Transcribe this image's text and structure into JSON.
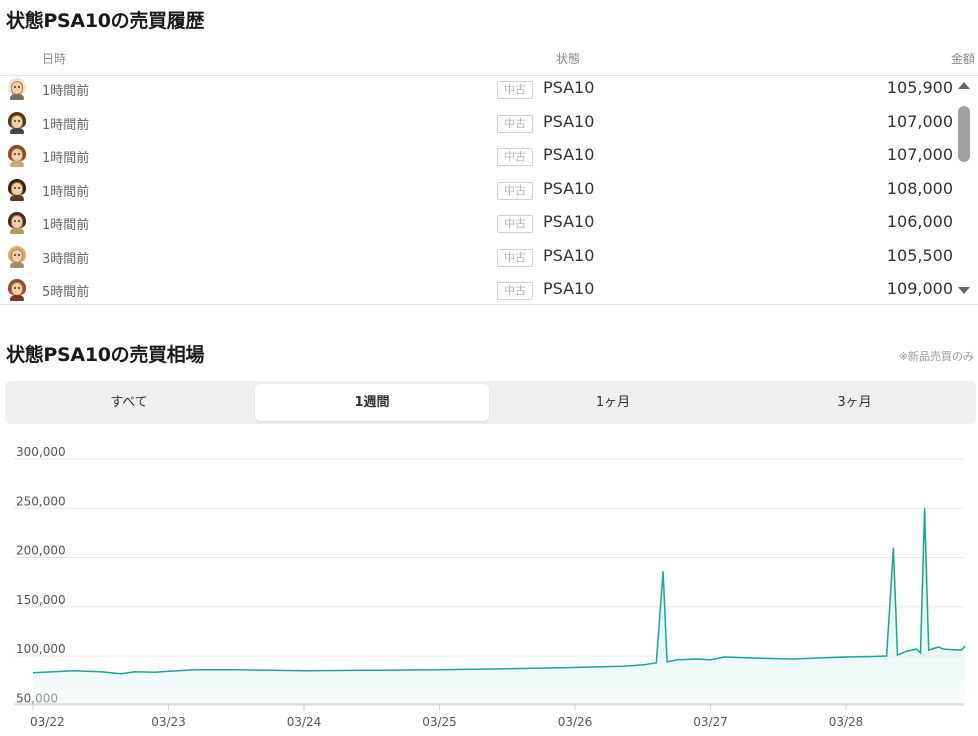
{
  "history": {
    "title": "状態PSA10の売買履歴",
    "headers": {
      "date": "日時",
      "condition": "状態",
      "price": "金額"
    },
    "rows": [
      {
        "time": "1時間前",
        "badge": "中古",
        "condition": "PSA10",
        "price": "105,900",
        "hair": "#f3e2c8",
        "shirt": "#7a6b5a"
      },
      {
        "time": "1時間前",
        "badge": "中古",
        "condition": "PSA10",
        "price": "107,000",
        "hair": "#5a3319",
        "shirt": "#444444"
      },
      {
        "time": "1時間前",
        "badge": "中古",
        "condition": "PSA10",
        "price": "107,000",
        "hair": "#8a4a22",
        "shirt": "#c9a77a"
      },
      {
        "time": "1時間前",
        "badge": "中古",
        "condition": "PSA10",
        "price": "108,000",
        "hair": "#3a2414",
        "shirt": "#5b3a20"
      },
      {
        "time": "1時間前",
        "badge": "中古",
        "condition": "PSA10",
        "price": "106,000",
        "hair": "#4a2a18",
        "shirt": "#b89766"
      },
      {
        "time": "3時間前",
        "badge": "中古",
        "condition": "PSA10",
        "price": "105,500",
        "hair": "#d9b26a",
        "shirt": "#a98c60"
      },
      {
        "time": "5時間前",
        "badge": "中古",
        "condition": "PSA10",
        "price": "109,000",
        "hair": "#9a4a26",
        "shirt": "#7a3a20"
      }
    ]
  },
  "market": {
    "title": "状態PSA10の売買相場",
    "note": "※新品売買のみ",
    "tabs": [
      {
        "label": "すべて",
        "active": false
      },
      {
        "label": "1週間",
        "active": true
      },
      {
        "label": "1ヶ月",
        "active": false
      },
      {
        "label": "3ヶ月",
        "active": false
      }
    ]
  },
  "colors": {
    "line": "#1aa596",
    "fill_top": "#b8e6df",
    "grid": "#e6e6e6",
    "axis_text": "#555555"
  },
  "chart_data": {
    "type": "area",
    "xlabel": "",
    "ylabel": "",
    "x_tick_labels": [
      "03/22",
      "03/23",
      "03/24",
      "03/25",
      "03/26",
      "03/27",
      "03/28"
    ],
    "y_tick_labels": [
      "300,000",
      "250,000",
      "200,000",
      "150,000",
      "100,000",
      "50,000"
    ],
    "y_ticks": [
      300000,
      250000,
      200000,
      150000,
      100000,
      50000
    ],
    "ylim": [
      42000,
      305000
    ],
    "xlim": [
      0,
      6.9
    ],
    "grid": true,
    "series": [
      {
        "points": [
          [
            0.0,
            83000
          ],
          [
            0.3,
            85000
          ],
          [
            0.5,
            84000
          ],
          [
            0.65,
            82000
          ],
          [
            0.75,
            84000
          ],
          [
            0.9,
            83500
          ],
          [
            1.0,
            84500
          ],
          [
            1.2,
            86000
          ],
          [
            1.5,
            86000
          ],
          [
            2.0,
            85000
          ],
          [
            2.5,
            85500
          ],
          [
            3.0,
            86000
          ],
          [
            3.5,
            87000
          ],
          [
            3.9,
            88000
          ],
          [
            4.2,
            89000
          ],
          [
            4.35,
            89500
          ],
          [
            4.5,
            91000
          ],
          [
            4.6,
            93000
          ],
          [
            4.65,
            186000
          ],
          [
            4.68,
            94000
          ],
          [
            4.75,
            96000
          ],
          [
            4.9,
            97000
          ],
          [
            5.0,
            96000
          ],
          [
            5.1,
            99000
          ],
          [
            5.3,
            98000
          ],
          [
            5.6,
            97000
          ],
          [
            5.8,
            98000
          ],
          [
            6.0,
            99000
          ],
          [
            6.2,
            99500
          ],
          [
            6.3,
            100000
          ],
          [
            6.35,
            210000
          ],
          [
            6.38,
            101000
          ],
          [
            6.45,
            105000
          ],
          [
            6.52,
            107000
          ],
          [
            6.55,
            103000
          ],
          [
            6.58,
            250000
          ],
          [
            6.61,
            106000
          ],
          [
            6.68,
            109000
          ],
          [
            6.72,
            107000
          ],
          [
            6.85,
            106000
          ],
          [
            6.88,
            110000
          ]
        ]
      }
    ]
  }
}
